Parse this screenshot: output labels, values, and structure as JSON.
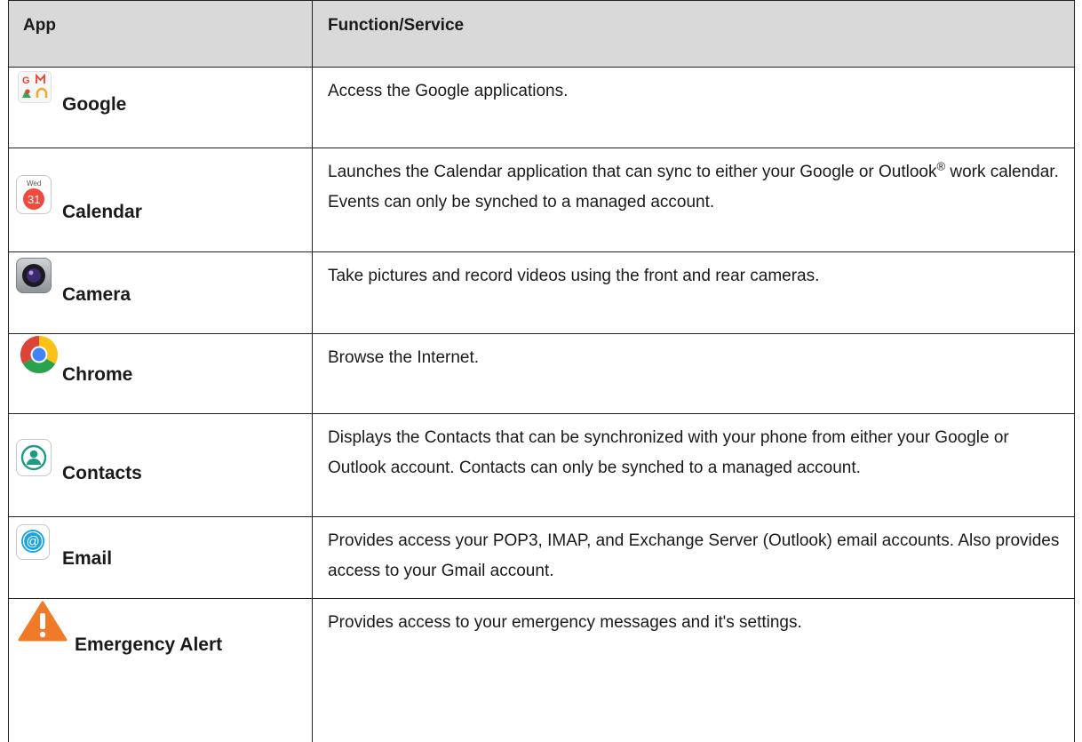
{
  "table": {
    "headers": {
      "app": "App",
      "function": "Function/Service"
    },
    "rows": [
      {
        "name": "Google",
        "icon": "google-apps-folder-icon",
        "description": "Access the Google applications.",
        "icon_letters": "G M"
      },
      {
        "name": "Calendar",
        "icon": "calendar-icon",
        "description_before_reg": "Launches the Calendar application that can sync to either your Google or Outlook",
        "reg_mark": "®",
        "description_after_reg": " work calendar. Events can only be synched to a managed account.",
        "icon_day": "Wed",
        "icon_date": "31"
      },
      {
        "name": "Camera",
        "icon": "camera-icon",
        "description": "Take pictures and record videos using the front and rear cameras."
      },
      {
        "name": "Chrome",
        "icon": "chrome-icon",
        "description": "Browse the Internet."
      },
      {
        "name": "Contacts",
        "icon": "contacts-icon",
        "description": "Displays the Contacts that can be synchronized with your phone from either your Google or Outlook account. Contacts can only be synched to a managed account."
      },
      {
        "name": "Email",
        "icon": "email-at-icon",
        "description": "Provides access your POP3, IMAP, and Exchange Server (Outlook) email accounts. Also provides access to your Gmail account."
      },
      {
        "name": "Emergency Alert",
        "icon": "warning-triangle-icon",
        "description": "Provides access to your emergency messages and it's settings."
      }
    ]
  },
  "colors": {
    "header_bg": "#d9d9d9",
    "border": "#222222",
    "calendar_red": "#f04a3c",
    "contacts_green": "#1d9c84",
    "email_blue": "#1aa3e0",
    "warning_orange": "#f07a28"
  }
}
